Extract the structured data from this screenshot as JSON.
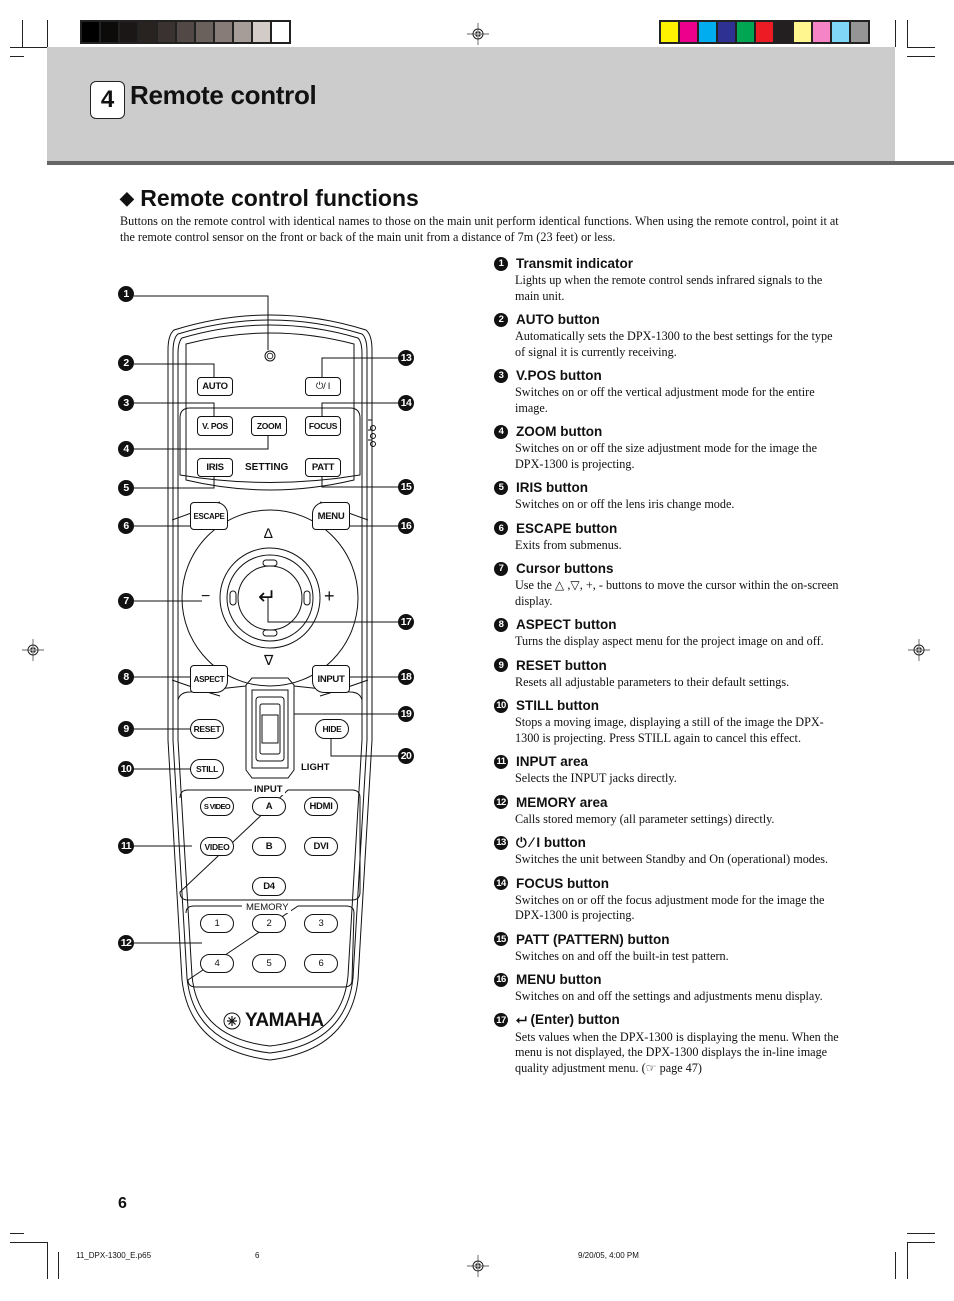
{
  "print_marks": {
    "gray_swatches": [
      "#000000",
      "#0d0b0a",
      "#1a1716",
      "#282220",
      "#3a3230",
      "#524845",
      "#6a605c",
      "#877c78",
      "#a69d98",
      "#d3cbc8",
      "#ffffff"
    ],
    "color_swatches": [
      "#fff200",
      "#ec008c",
      "#00aeef",
      "#2e3192",
      "#00a651",
      "#ed1c24",
      "#231f20",
      "#fff68f",
      "#f584c6",
      "#7fd6f7",
      "#959595"
    ]
  },
  "header": {
    "chapter_number": "4",
    "chapter_title": "Remote control"
  },
  "section": {
    "title": "Remote control functions",
    "bullet_glyph": "◆",
    "intro": "Buttons on the remote control with identical names to those on the main unit perform identical functions. When using the remote control, point it at the remote control sensor on the front or back of the main unit from a distance of 7m (23 feet) or less."
  },
  "remote": {
    "buttons": {
      "auto": "AUTO",
      "power": "⏻/ I",
      "vpos": "V. POS",
      "zoom": "ZOOM",
      "focus": "FOCUS",
      "iris": "IRIS",
      "setting_label": "SETTING",
      "patt": "PATT",
      "escape": "ESCAPE",
      "menu": "MENU",
      "up": "∆",
      "down": "∇",
      "minus": "−",
      "plus": "+",
      "enter": "↵",
      "aspect": "ASPECT",
      "input": "INPUT",
      "reset": "RESET",
      "hide": "HIDE",
      "still": "STILL",
      "light_label": "LIGHT",
      "input_area_label": "INPUT",
      "svideo": "S VIDEO",
      "a": "A",
      "hdmi": "HDMI",
      "video": "VIDEO",
      "b": "B",
      "dvi": "DVI",
      "d4": "D4",
      "memory_area_label": "MEMORY",
      "mem1": "1",
      "mem2": "2",
      "mem3": "3",
      "mem4": "4",
      "mem5": "5",
      "mem6": "6",
      "brand": "YAMAHA"
    },
    "callouts": [
      "1",
      "2",
      "3",
      "4",
      "5",
      "6",
      "7",
      "8",
      "9",
      "10",
      "11",
      "12",
      "13",
      "14",
      "15",
      "16",
      "17",
      "18",
      "19",
      "20"
    ]
  },
  "items": [
    {
      "num": "1",
      "title": "Transmit indicator",
      "desc": "Lights up when the remote control sends infrared signals to the main unit."
    },
    {
      "num": "2",
      "title": "AUTO button",
      "desc": "Automatically sets the DPX-1300 to the best settings for the type of signal it is currently receiving."
    },
    {
      "num": "3",
      "title": "V.POS button",
      "desc": "Switches on or off the vertical adjustment mode for the entire image."
    },
    {
      "num": "4",
      "title": "ZOOM button",
      "desc": "Switches on or off the size adjustment mode for the image the DPX-1300 is projecting."
    },
    {
      "num": "5",
      "title": "IRIS button",
      "desc": "Switches on or off the lens iris change mode."
    },
    {
      "num": "6",
      "title": "ESCAPE button",
      "desc": "Exits from submenus."
    },
    {
      "num": "7",
      "title": "Cursor buttons",
      "desc": "Use the △ ,▽, +, - buttons to move the cursor within the on-screen display."
    },
    {
      "num": "8",
      "title": "ASPECT button",
      "desc": "Turns the display aspect menu for the project image on and off."
    },
    {
      "num": "9",
      "title": "RESET button",
      "desc": "Resets all adjustable parameters to their default settings."
    },
    {
      "num": "10",
      "title": "STILL button",
      "desc": "Stops a moving image, displaying a still of the image the DPX-1300 is projecting. Press STILL again to cancel this effect."
    },
    {
      "num": "11",
      "title": "INPUT area",
      "desc": "Selects the INPUT jacks directly."
    },
    {
      "num": "12",
      "title": "MEMORY area",
      "desc": "Calls stored memory (all parameter settings) directly."
    },
    {
      "num": "13",
      "title": "⏻ ⁄ I button",
      "desc": "Switches the unit between Standby and On (operational) modes."
    },
    {
      "num": "14",
      "title": "FOCUS button",
      "desc": "Switches on or off the focus adjustment mode for the image the DPX-1300 is projecting."
    },
    {
      "num": "15",
      "title": "PATT (PATTERN) button",
      "desc": "Switches on and off the built-in test pattern."
    },
    {
      "num": "16",
      "title": "MENU button",
      "desc": "Switches on and off the settings and adjustments menu display."
    },
    {
      "num": "17",
      "title": "⮠ (Enter) button",
      "desc": "Sets values when the DPX-1300 is displaying the menu. When the menu is not displayed, the DPX-1300 displays the in-line image quality adjustment menu. (☞ page 47)"
    }
  ],
  "footer": {
    "page_number": "6",
    "slug_file": "11_DPX-1300_E.p65",
    "slug_page": "6",
    "slug_date": "9/20/05, 4:00 PM"
  }
}
